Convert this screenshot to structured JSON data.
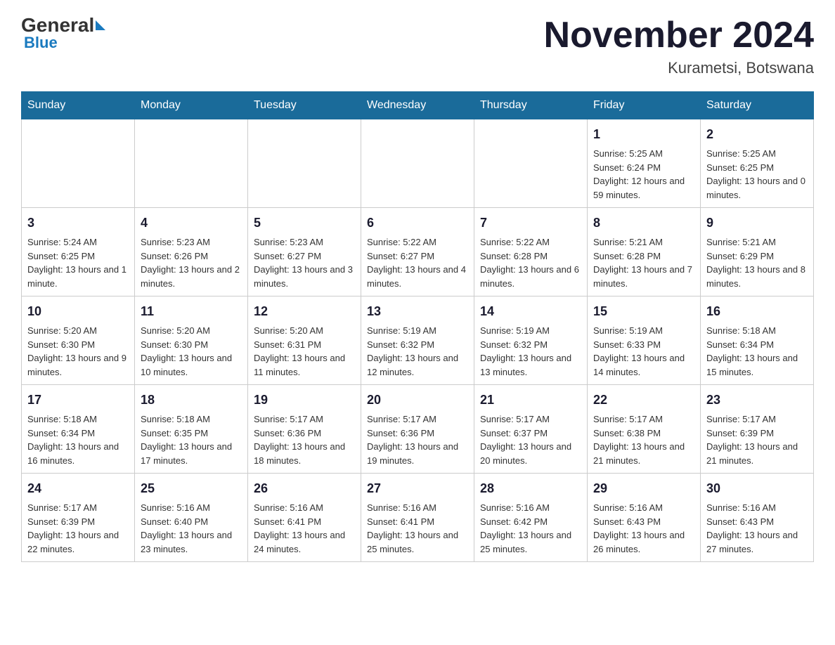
{
  "header": {
    "logo_text": "General",
    "logo_blue": "Blue",
    "month_title": "November 2024",
    "location": "Kurametsi, Botswana"
  },
  "weekdays": [
    "Sunday",
    "Monday",
    "Tuesday",
    "Wednesday",
    "Thursday",
    "Friday",
    "Saturday"
  ],
  "weeks": [
    [
      {
        "day": "",
        "info": ""
      },
      {
        "day": "",
        "info": ""
      },
      {
        "day": "",
        "info": ""
      },
      {
        "day": "",
        "info": ""
      },
      {
        "day": "",
        "info": ""
      },
      {
        "day": "1",
        "info": "Sunrise: 5:25 AM\nSunset: 6:24 PM\nDaylight: 12 hours and 59 minutes."
      },
      {
        "day": "2",
        "info": "Sunrise: 5:25 AM\nSunset: 6:25 PM\nDaylight: 13 hours and 0 minutes."
      }
    ],
    [
      {
        "day": "3",
        "info": "Sunrise: 5:24 AM\nSunset: 6:25 PM\nDaylight: 13 hours and 1 minute."
      },
      {
        "day": "4",
        "info": "Sunrise: 5:23 AM\nSunset: 6:26 PM\nDaylight: 13 hours and 2 minutes."
      },
      {
        "day": "5",
        "info": "Sunrise: 5:23 AM\nSunset: 6:27 PM\nDaylight: 13 hours and 3 minutes."
      },
      {
        "day": "6",
        "info": "Sunrise: 5:22 AM\nSunset: 6:27 PM\nDaylight: 13 hours and 4 minutes."
      },
      {
        "day": "7",
        "info": "Sunrise: 5:22 AM\nSunset: 6:28 PM\nDaylight: 13 hours and 6 minutes."
      },
      {
        "day": "8",
        "info": "Sunrise: 5:21 AM\nSunset: 6:28 PM\nDaylight: 13 hours and 7 minutes."
      },
      {
        "day": "9",
        "info": "Sunrise: 5:21 AM\nSunset: 6:29 PM\nDaylight: 13 hours and 8 minutes."
      }
    ],
    [
      {
        "day": "10",
        "info": "Sunrise: 5:20 AM\nSunset: 6:30 PM\nDaylight: 13 hours and 9 minutes."
      },
      {
        "day": "11",
        "info": "Sunrise: 5:20 AM\nSunset: 6:30 PM\nDaylight: 13 hours and 10 minutes."
      },
      {
        "day": "12",
        "info": "Sunrise: 5:20 AM\nSunset: 6:31 PM\nDaylight: 13 hours and 11 minutes."
      },
      {
        "day": "13",
        "info": "Sunrise: 5:19 AM\nSunset: 6:32 PM\nDaylight: 13 hours and 12 minutes."
      },
      {
        "day": "14",
        "info": "Sunrise: 5:19 AM\nSunset: 6:32 PM\nDaylight: 13 hours and 13 minutes."
      },
      {
        "day": "15",
        "info": "Sunrise: 5:19 AM\nSunset: 6:33 PM\nDaylight: 13 hours and 14 minutes."
      },
      {
        "day": "16",
        "info": "Sunrise: 5:18 AM\nSunset: 6:34 PM\nDaylight: 13 hours and 15 minutes."
      }
    ],
    [
      {
        "day": "17",
        "info": "Sunrise: 5:18 AM\nSunset: 6:34 PM\nDaylight: 13 hours and 16 minutes."
      },
      {
        "day": "18",
        "info": "Sunrise: 5:18 AM\nSunset: 6:35 PM\nDaylight: 13 hours and 17 minutes."
      },
      {
        "day": "19",
        "info": "Sunrise: 5:17 AM\nSunset: 6:36 PM\nDaylight: 13 hours and 18 minutes."
      },
      {
        "day": "20",
        "info": "Sunrise: 5:17 AM\nSunset: 6:36 PM\nDaylight: 13 hours and 19 minutes."
      },
      {
        "day": "21",
        "info": "Sunrise: 5:17 AM\nSunset: 6:37 PM\nDaylight: 13 hours and 20 minutes."
      },
      {
        "day": "22",
        "info": "Sunrise: 5:17 AM\nSunset: 6:38 PM\nDaylight: 13 hours and 21 minutes."
      },
      {
        "day": "23",
        "info": "Sunrise: 5:17 AM\nSunset: 6:39 PM\nDaylight: 13 hours and 21 minutes."
      }
    ],
    [
      {
        "day": "24",
        "info": "Sunrise: 5:17 AM\nSunset: 6:39 PM\nDaylight: 13 hours and 22 minutes."
      },
      {
        "day": "25",
        "info": "Sunrise: 5:16 AM\nSunset: 6:40 PM\nDaylight: 13 hours and 23 minutes."
      },
      {
        "day": "26",
        "info": "Sunrise: 5:16 AM\nSunset: 6:41 PM\nDaylight: 13 hours and 24 minutes."
      },
      {
        "day": "27",
        "info": "Sunrise: 5:16 AM\nSunset: 6:41 PM\nDaylight: 13 hours and 25 minutes."
      },
      {
        "day": "28",
        "info": "Sunrise: 5:16 AM\nSunset: 6:42 PM\nDaylight: 13 hours and 25 minutes."
      },
      {
        "day": "29",
        "info": "Sunrise: 5:16 AM\nSunset: 6:43 PM\nDaylight: 13 hours and 26 minutes."
      },
      {
        "day": "30",
        "info": "Sunrise: 5:16 AM\nSunset: 6:43 PM\nDaylight: 13 hours and 27 minutes."
      }
    ]
  ]
}
